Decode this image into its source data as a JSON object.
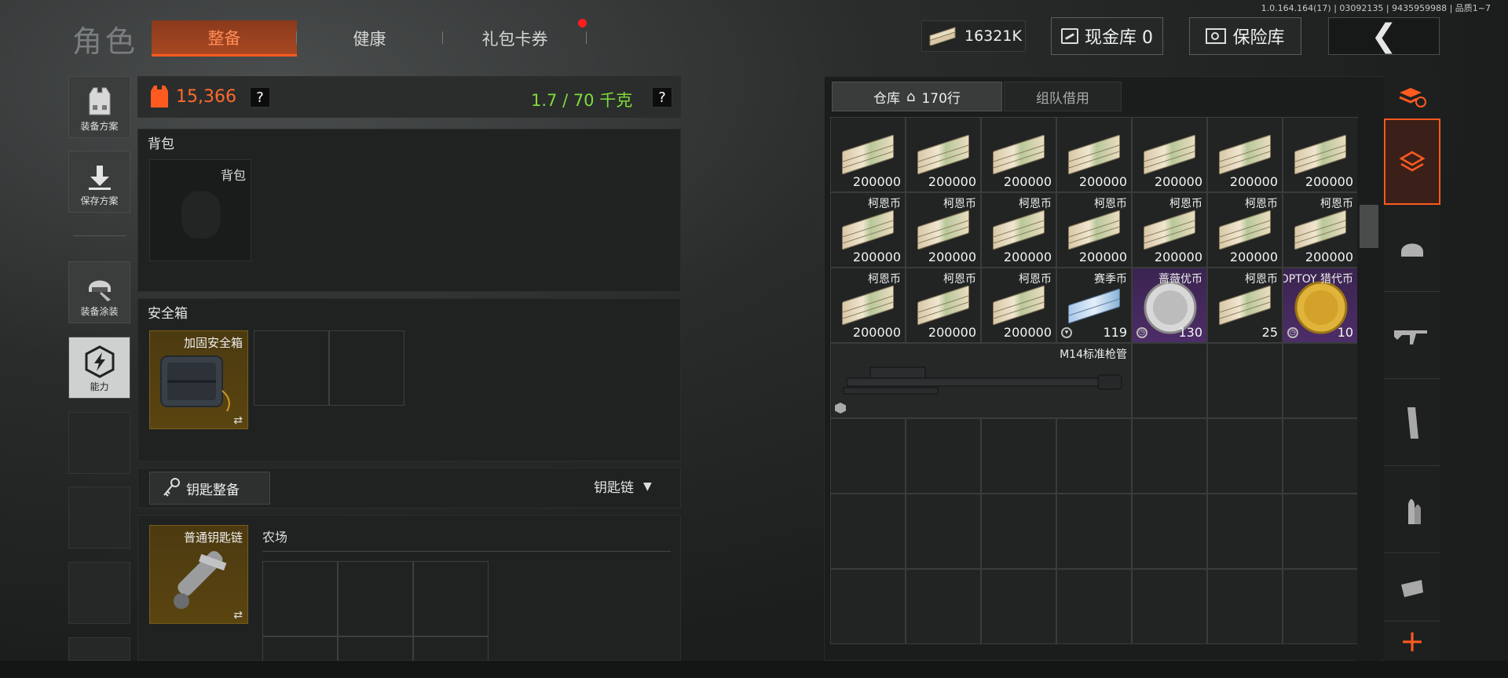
{
  "version": "1.0.164.164(17) | 03092135 | 9435959988 | 品质1~7",
  "header": {
    "title": "角色",
    "tabs": [
      {
        "label": "整备",
        "active": true
      },
      {
        "label": "健康",
        "active": false
      },
      {
        "label": "礼包卡券",
        "active": false
      }
    ],
    "cash": "16321K",
    "cash_vault": "现金库 0",
    "insured_vault": "保险库"
  },
  "sidebar": {
    "items": [
      {
        "label": "装备方案",
        "icon": "vest-icon"
      },
      {
        "label": "保存方案",
        "icon": "download-icon"
      },
      {
        "label": "装备涂装",
        "icon": "helmet-paint-icon"
      },
      {
        "label": "能力",
        "icon": "lightning-icon"
      }
    ]
  },
  "loadout": {
    "value": "15,366",
    "help": "?",
    "weight": "1.7 / 70 千克",
    "weight_help": "?"
  },
  "backpack": {
    "section_label": "背包",
    "slot_label": "背包"
  },
  "safebox": {
    "section_label": "安全箱",
    "item_name": "加固安全箱",
    "swap": "⇄"
  },
  "keys": {
    "button_label": "钥匙整备",
    "dropdown_label": "钥匙链",
    "item_name": "普通钥匙链",
    "swap": "⇄",
    "location": "农场"
  },
  "inventory": {
    "tabs": [
      {
        "label": "仓库",
        "count": "170行",
        "active": true
      },
      {
        "label": "组队借用",
        "active": false
      }
    ],
    "items": [
      {
        "name": "",
        "qty": "200000",
        "kind": "money"
      },
      {
        "name": "",
        "qty": "200000",
        "kind": "money"
      },
      {
        "name": "",
        "qty": "200000",
        "kind": "money"
      },
      {
        "name": "",
        "qty": "200000",
        "kind": "money"
      },
      {
        "name": "",
        "qty": "200000",
        "kind": "money"
      },
      {
        "name": "",
        "qty": "200000",
        "kind": "money"
      },
      {
        "name": "",
        "qty": "200000",
        "kind": "money"
      },
      {
        "name": "柯恩币",
        "qty": "200000",
        "kind": "money"
      },
      {
        "name": "柯恩币",
        "qty": "200000",
        "kind": "money"
      },
      {
        "name": "柯恩币",
        "qty": "200000",
        "kind": "money"
      },
      {
        "name": "柯恩币",
        "qty": "200000",
        "kind": "money"
      },
      {
        "name": "柯恩币",
        "qty": "200000",
        "kind": "money"
      },
      {
        "name": "柯恩币",
        "qty": "200000",
        "kind": "money"
      },
      {
        "name": "柯恩币",
        "qty": "200000",
        "kind": "money"
      },
      {
        "name": "柯恩币",
        "qty": "200000",
        "kind": "money"
      },
      {
        "name": "柯恩币",
        "qty": "200000",
        "kind": "money"
      },
      {
        "name": "柯恩币",
        "qty": "200000",
        "kind": "money"
      },
      {
        "name": "赛季币",
        "qty": "119",
        "kind": "season"
      },
      {
        "name": "蔷薇优币",
        "qty": "130",
        "kind": "silver"
      },
      {
        "name": "柯恩币",
        "qty": "25",
        "kind": "money"
      },
      {
        "name": "TOPTOY 猎代币",
        "qty": "10",
        "kind": "gold"
      }
    ],
    "long_item": {
      "name": "M14标准枪管"
    }
  },
  "rail": {
    "items": [
      "stack-refresh-icon",
      "stack-icon",
      "helmet-icon",
      "rifle-icon",
      "magazine-icon",
      "ammo-icon",
      "sight-icon",
      "plus-icon"
    ]
  },
  "colors": {
    "accent": "#ff5a1f",
    "weight_ok": "#7ddc3a",
    "value_orange": "#ff6a2a"
  }
}
